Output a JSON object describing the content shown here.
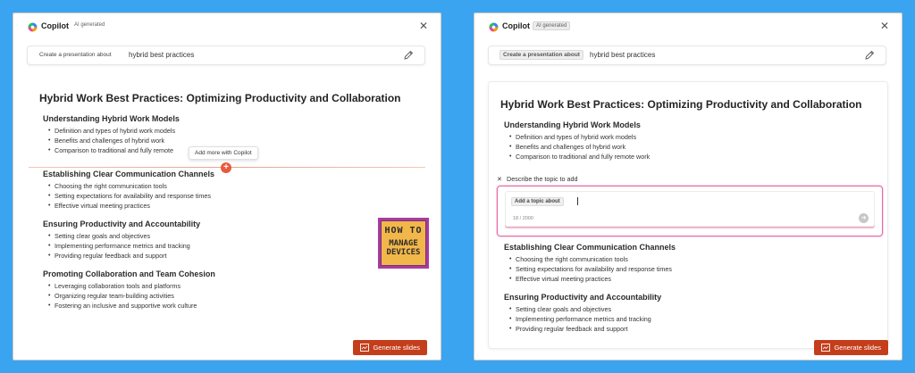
{
  "colors": {
    "background": "#3aa4f0",
    "accent": "#c43e1c",
    "insert_accent": "#e8593b",
    "focus_border": "#e86aa8"
  },
  "left": {
    "app_name": "Copilot",
    "ai_badge": "AI generated",
    "prompt_prefix": "Create a presentation about",
    "prompt_topic": "hybrid best practices",
    "title": "Hybrid Work Best Practices: Optimizing Productivity and Collaboration",
    "tooltip": "Add more with Copilot",
    "insert_icon": "+",
    "sections": [
      {
        "title": "Understanding Hybrid Work Models",
        "items": [
          "Definition and types of hybrid work models",
          "Benefits and challenges of hybrid work",
          "Comparison to traditional and fully remote"
        ]
      },
      {
        "title": "Establishing Clear Communication Channels",
        "items": [
          "Choosing the right communication tools",
          "Setting expectations for availability and response times",
          "Effective virtual meeting practices"
        ]
      },
      {
        "title": "Ensuring Productivity and Accountability",
        "items": [
          "Setting clear goals and objectives",
          "Implementing performance metrics and tracking",
          "Providing regular feedback and support"
        ]
      },
      {
        "title": "Promoting Collaboration and Team Cohesion",
        "items": [
          "Leveraging collaboration tools and platforms",
          "Organizing regular team-building activities",
          "Fostering an inclusive and supportive work culture"
        ]
      }
    ],
    "generate_label": "Generate slides",
    "watermark": {
      "line1": "HOW TO",
      "line2": "MANAGE",
      "line3": "DEVICES"
    }
  },
  "right": {
    "app_name": "Copilot",
    "ai_badge": "AI generated",
    "prompt_prefix": "Create a presentation about",
    "prompt_topic": "hybrid best practices",
    "title": "Hybrid Work Best Practices: Optimizing Productivity and Collaboration",
    "sections_top": [
      {
        "title": "Understanding Hybrid Work Models",
        "items": [
          "Definition and types of hybrid work models",
          "Benefits and challenges of hybrid work",
          "Comparison to traditional and fully remote work"
        ]
      }
    ],
    "describe_label": "Describe the topic to add",
    "add_chip": "Add a topic about",
    "char_count": "18 / 2000",
    "sections_bottom": [
      {
        "title": "Establishing Clear Communication Channels",
        "items": [
          "Choosing the right communication tools",
          "Setting expectations for availability and response times",
          "Effective virtual meeting practices"
        ]
      },
      {
        "title": "Ensuring Productivity and Accountability",
        "items": [
          "Setting clear goals and objectives",
          "Implementing performance metrics and tracking",
          "Providing regular feedback and support"
        ]
      }
    ],
    "generate_label": "Generate slides"
  },
  "icons": {
    "close": "✕",
    "send": "➜"
  }
}
